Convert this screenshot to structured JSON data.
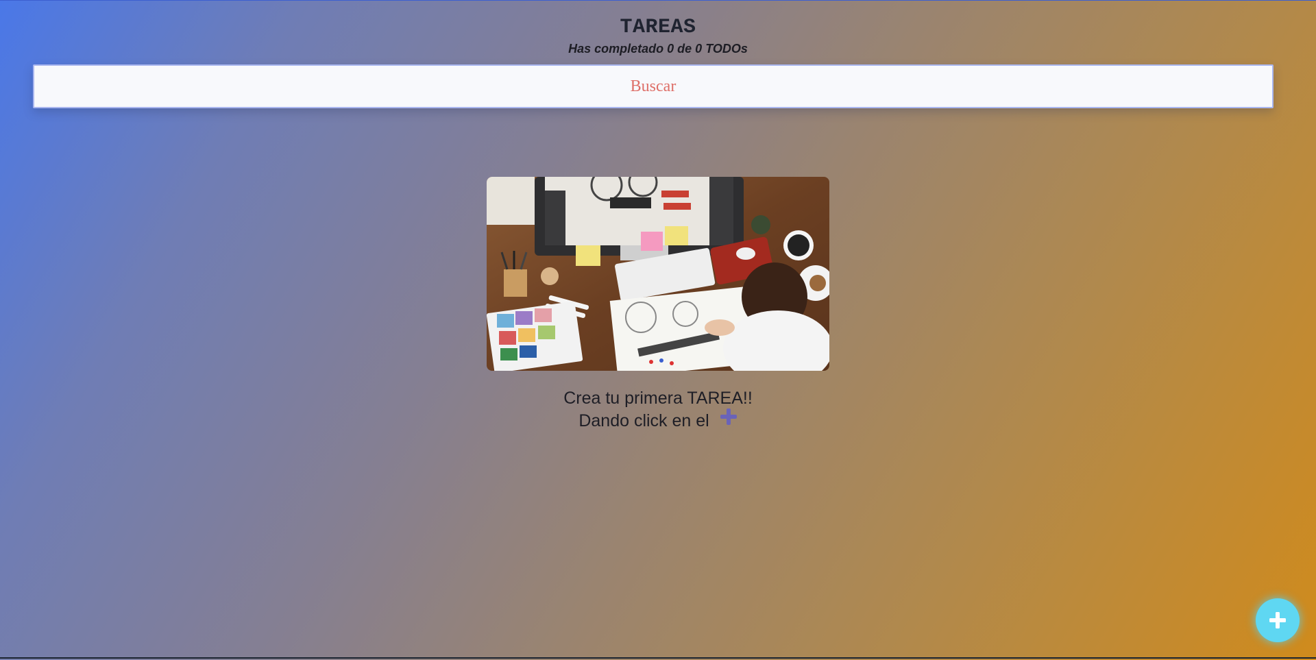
{
  "header": {
    "title": "TAREAS",
    "counter_text": "Has completado 0 de 0 TODOs"
  },
  "search": {
    "placeholder": "Buscar",
    "value": ""
  },
  "empty_state": {
    "line1": "Crea tu primera TAREA!!",
    "line2": "Dando click en el",
    "inline_icon": "plus-icon",
    "image_description_icon": "designer-desk-illustration"
  },
  "fab": {
    "icon": "plus-icon"
  },
  "colors": {
    "gradient_start": "#4a78e8",
    "gradient_end": "#d08b1c",
    "search_text": "#de6f68",
    "fab": "#5fd7f2",
    "inline_plus": "#6a63b8"
  }
}
